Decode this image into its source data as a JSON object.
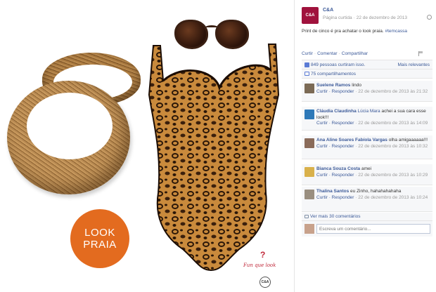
{
  "photo": {
    "badge_line1": "LOOK",
    "badge_line2": "PRAIA",
    "watermark_text": "Fun que look",
    "watermark_logo": "C&A"
  },
  "post": {
    "page_avatar_text": "C&A",
    "page_name": "C&A",
    "page_type": "Página curtida",
    "date": "22 de dezembro de 2013",
    "caption_text": "Print de cinco é pra achatar o look praia. ",
    "caption_tag": "#temcassa",
    "actions": [
      "Curtir",
      "Comentar",
      "Compartilhar"
    ],
    "likes_text": "849 pessoas curtiram isso.",
    "most_relevant": "Mais relevantes",
    "shares_text": "75 compartilhamentos"
  },
  "comments": [
    {
      "author": "Suelene Ramos",
      "text": "lindo",
      "reply": "Curtir · Responder",
      "time": "22 de dezembro de 2013 às 21:32",
      "avatar_color": "#7b6a55"
    },
    {
      "author": "Cláudia Claudinha",
      "mention": "Lúcia Mara",
      "text": "achei a sua cara esse look!!!",
      "reply": "Curtir · Responder",
      "time": "22 de dezembro de 2013 às 14:09",
      "avatar_color": "#2e79b8"
    },
    {
      "author": "Ana Aline Soares Fabíola Vargas",
      "text": "olha amigaaaaaa!!!",
      "reply": "Curtir · Responder",
      "time": "22 de dezembro de 2013 às 10:32",
      "avatar_color": "#8a6b5a"
    },
    {
      "author": "Bianca Souza Costa",
      "text": "amei",
      "reply": "Curtir · Responder",
      "time": "22 de dezembro de 2013 às 10:29",
      "avatar_color": "#d9b14b"
    },
    {
      "author": "Thalina Santos",
      "text": "eu Zinho, hahahahahaha",
      "reply": "Curtir · Responder",
      "time": "22 de dezembro de 2013 às 10:24",
      "avatar_color": "#9a8f80"
    }
  ],
  "more_comments": "Ver mais 30 comentários",
  "write_placeholder": "Escreva um comentário..."
}
